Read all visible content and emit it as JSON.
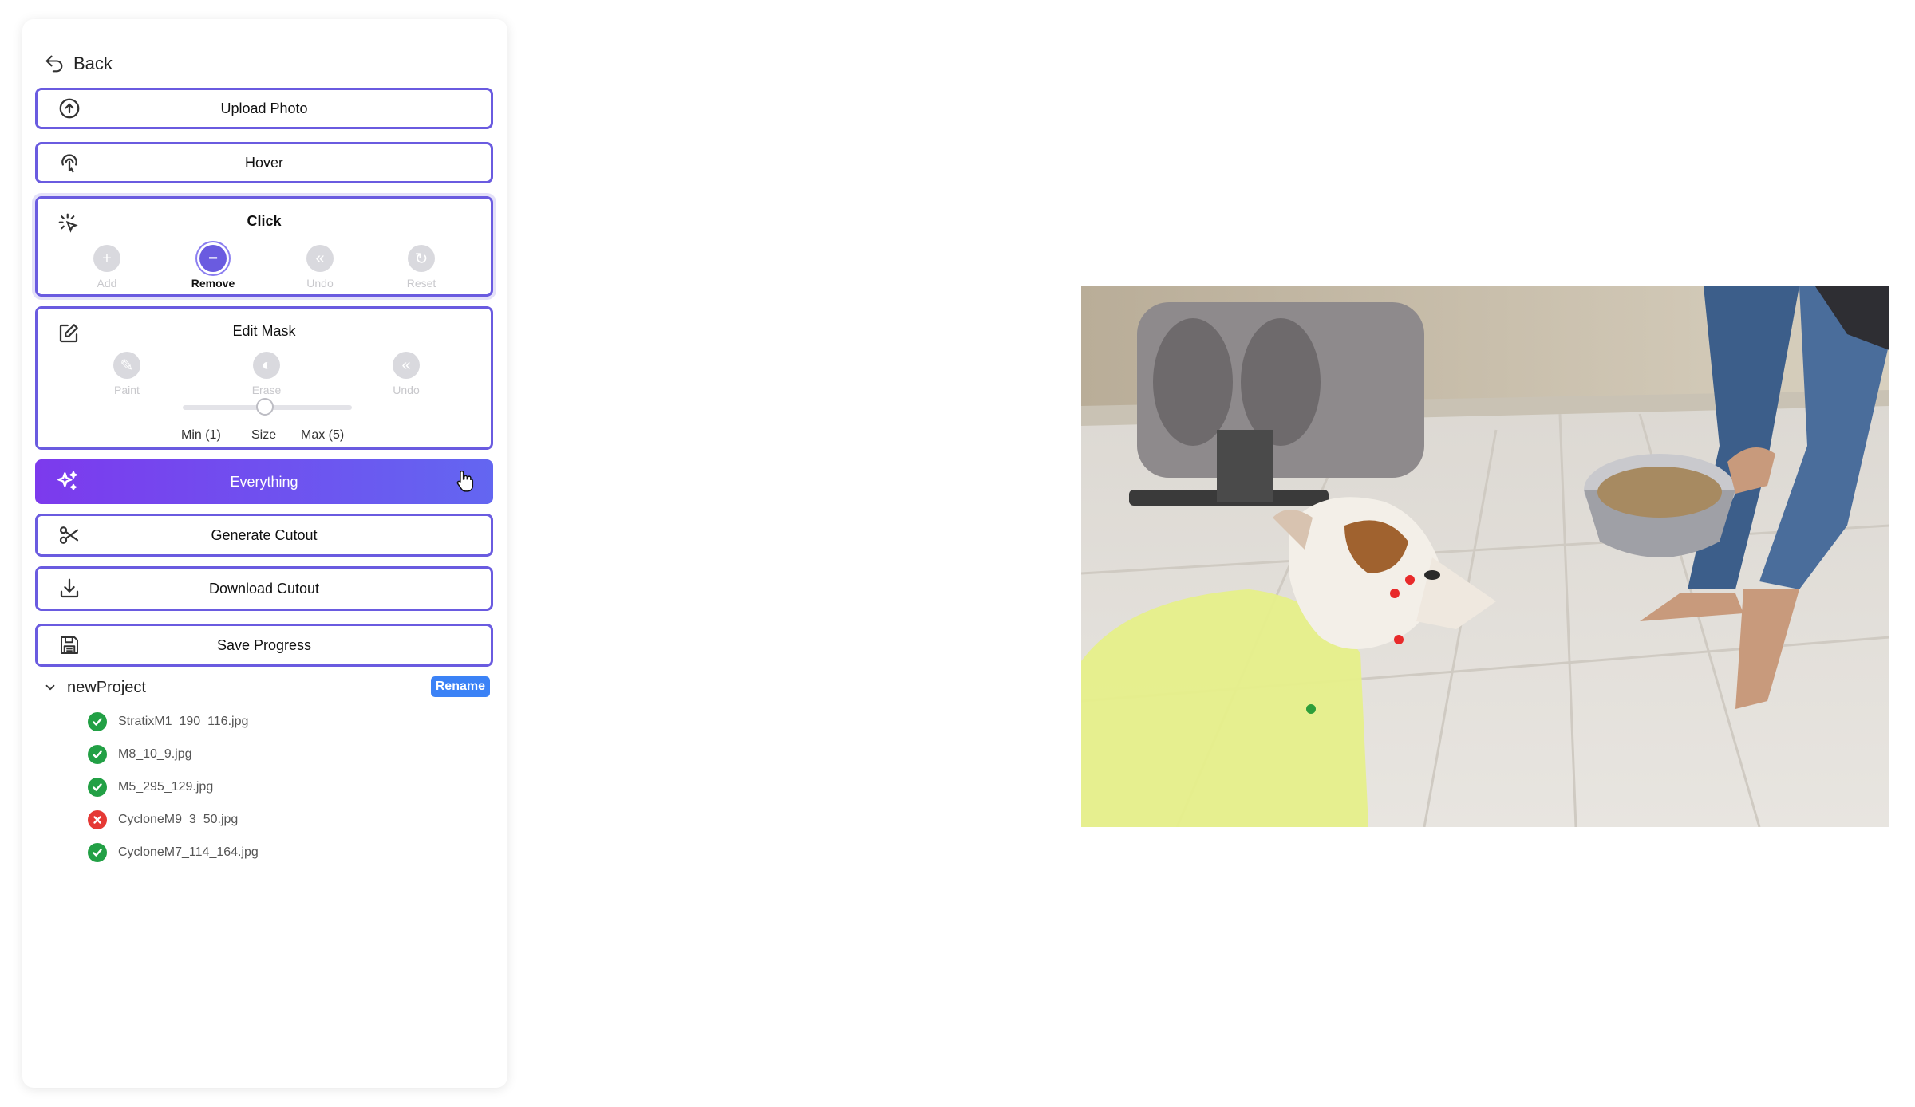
{
  "nav": {
    "back_label": "Back"
  },
  "buttons": {
    "upload": "Upload Photo",
    "hover": "Hover",
    "everything": "Everything",
    "generate": "Generate Cutout",
    "download": "Download Cutout",
    "save": "Save Progress"
  },
  "click_panel": {
    "title": "Click",
    "tools": [
      {
        "label": "Add",
        "state": "disabled"
      },
      {
        "label": "Remove",
        "state": "selected"
      },
      {
        "label": "Undo",
        "state": "disabled"
      },
      {
        "label": "Reset",
        "state": "disabled"
      }
    ]
  },
  "edit_mask": {
    "title": "Edit Mask",
    "tools": [
      {
        "label": "Paint",
        "state": "disabled"
      },
      {
        "label": "Erase",
        "state": "disabled"
      },
      {
        "label": "Undo",
        "state": "disabled"
      }
    ],
    "slider": {
      "min_label": "Min (1)",
      "label": "Size",
      "max_label": "Max (5)",
      "value": 3,
      "min": 1,
      "max": 5
    }
  },
  "project": {
    "name": "newProject",
    "rename_label": "Rename",
    "files": [
      {
        "name": "StratixM1_190_116.jpg",
        "status": "done"
      },
      {
        "name": "M8_10_9.jpg",
        "status": "done"
      },
      {
        "name": "M5_295_129.jpg",
        "status": "done"
      },
      {
        "name": "CycloneM9_3_50.jpg",
        "status": "error"
      },
      {
        "name": "CycloneM7_114_164.jpg",
        "status": "done"
      }
    ]
  },
  "colors": {
    "accent": "#6a5be0",
    "success": "#22a045",
    "error": "#e53935",
    "rename": "#3b82f6"
  },
  "canvas": {
    "point_colors": {
      "remove": "#e82a2a",
      "add": "#2e9e3a"
    },
    "mask_color": "#e6ef8a"
  }
}
